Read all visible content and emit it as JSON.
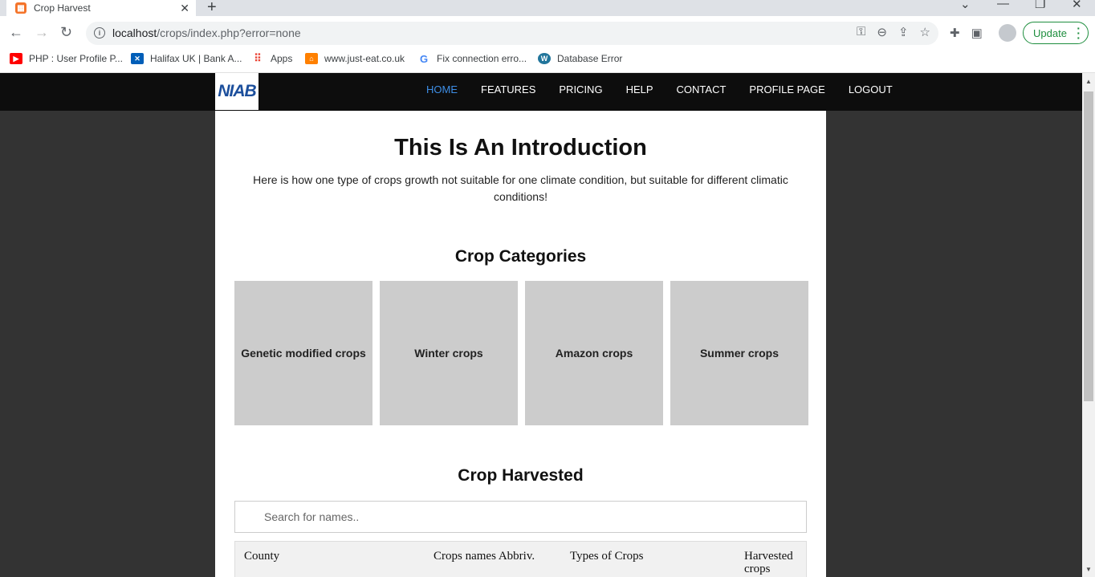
{
  "browser": {
    "tab_title": "Crop Harvest",
    "favicon_letter": "❖",
    "new_tab_symbol": "+",
    "url_host": "localhost",
    "url_path": "/crops/index.php?error=none",
    "update_label": "Update",
    "bookmarks": [
      {
        "label": "PHP : User Profile P...",
        "icon": "youtube-icon",
        "color": "#ff0000"
      },
      {
        "label": "Halifax UK | Bank A...",
        "icon": "halifax-icon",
        "color": "#005eb8"
      },
      {
        "label": "Apps",
        "icon": "apps-grid-icon",
        "color": "#ea4335"
      },
      {
        "label": "www.just-eat.co.uk",
        "icon": "just-eat-icon",
        "color": "#ff8000"
      },
      {
        "label": "Fix connection erro...",
        "icon": "google-icon",
        "color": "#4285f4"
      },
      {
        "label": "Database Error",
        "icon": "wordpress-icon",
        "color": "#21759b"
      }
    ]
  },
  "site": {
    "logo_text": "NIAB",
    "nav": [
      "HOME",
      "FEATURES",
      "PRICING",
      "HELP",
      "CONTACT",
      "PROFILE PAGE",
      "LOGOUT"
    ],
    "active_nav": "HOME",
    "accent_color": "#3e8ee6"
  },
  "intro": {
    "title": "This Is An Introduction",
    "text": "Here is how one type of crops growth not suitable for one climate condition, but suitable for different climatic conditions!"
  },
  "categories": {
    "title": "Crop Categories",
    "items": [
      "Genetic modified crops",
      "Winter crops",
      "Amazon crops",
      "Summer crops"
    ]
  },
  "harvested": {
    "title": "Crop Harvested",
    "search_placeholder": "Search for names..",
    "columns": [
      "County",
      "Crops names Abbriv.",
      "Types of Crops",
      "Harvested crops"
    ]
  }
}
